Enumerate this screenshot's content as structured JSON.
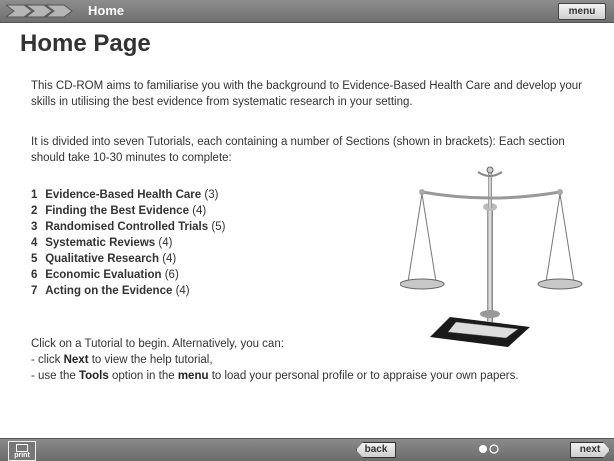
{
  "header": {
    "title": "Home",
    "menu_label": "menu"
  },
  "page": {
    "title": "Home Page",
    "intro": "This CD-ROM aims to familiarise you with the background to Evidence-Based Health Care and develop your skills in utilising the best evidence from systematic research in your setting.",
    "divided": "It is divided into seven Tutorials, each containing a number of Sections (shown in brackets): Each section should take 10-30 minutes to complete:"
  },
  "tutorials": [
    {
      "num": "1",
      "name": "Evidence-Based Health Care",
      "count": "(3)"
    },
    {
      "num": "2",
      "name": "Finding the Best Evidence",
      "count": "(4)"
    },
    {
      "num": "3",
      "name": "Randomised Controlled Trials",
      "count": "(5)"
    },
    {
      "num": "4",
      "name": "Systematic Reviews",
      "count": "(4)"
    },
    {
      "num": "5",
      "name": "Qualitative Research",
      "count": "(4)"
    },
    {
      "num": "6",
      "name": "Economic Evaluation",
      "count": "(6)"
    },
    {
      "num": "7",
      "name": "Acting on the Evidence",
      "count": "(4)"
    }
  ],
  "instructions": {
    "lead": "Click on a Tutorial to begin.  Alternatively, you can:",
    "b1_pre": "-   click ",
    "b1_bold": "Next",
    "b1_post": " to view the help tutorial,",
    "b2_pre": "-   use the ",
    "b2_bold1": "Tools",
    "b2_mid": " option in the ",
    "b2_bold2": "menu",
    "b2_post": " to load your personal profile or to appraise your own papers."
  },
  "footer": {
    "print_label": "print",
    "back_label": "back",
    "next_label": "next"
  }
}
